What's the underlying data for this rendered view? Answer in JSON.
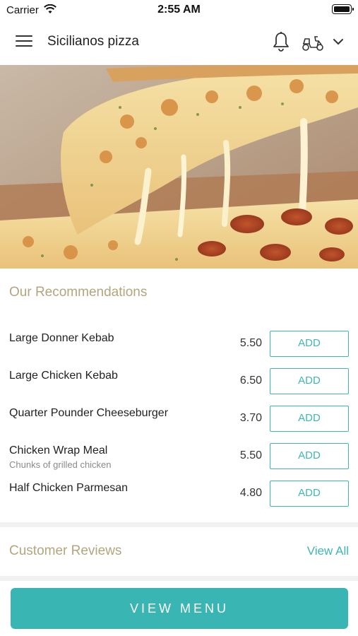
{
  "status_bar": {
    "carrier": "Carrier",
    "time": "2:55 AM"
  },
  "header": {
    "title": "Sicilianos pizza",
    "icons": [
      "menu-icon",
      "bell-icon",
      "scooter-icon",
      "chevron-down-icon"
    ]
  },
  "hero": {
    "image": "cheese pizza slice photo"
  },
  "recommendations": {
    "title": "Our Recommendations",
    "items": [
      {
        "name": "Large Donner Kebab",
        "description": "",
        "price": "5.50",
        "button": "ADD"
      },
      {
        "name": "Large Chicken Kebab",
        "description": "",
        "price": "6.50",
        "button": "ADD"
      },
      {
        "name": "Quarter Pounder Cheeseburger",
        "description": "",
        "price": "3.70",
        "button": "ADD"
      },
      {
        "name": "Chicken Wrap Meal",
        "description": "Chunks of grilled chicken",
        "price": "5.50",
        "button": "ADD"
      },
      {
        "name": "Half Chicken Parmesan",
        "description": "",
        "price": "4.80",
        "button": "ADD"
      }
    ]
  },
  "reviews": {
    "title": "Customer Reviews",
    "view_all": "View All"
  },
  "footer": {
    "view_menu": "VIEW MENU"
  },
  "colors": {
    "accent": "#3fb6b6",
    "section_title": "#b3a57e",
    "button_fill": "#39b5b3"
  }
}
